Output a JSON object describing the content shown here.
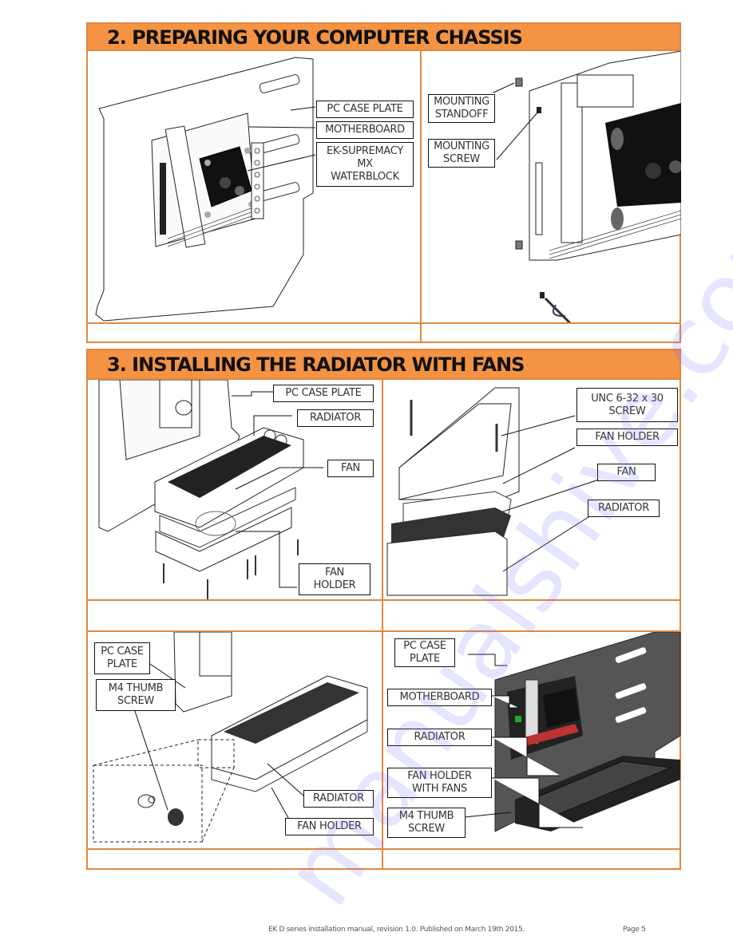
{
  "section2": {
    "title": "2.  PREPARING YOUR COMPUTER CHASSIS",
    "left_panel": {
      "labels": [
        "PC CASE PLATE",
        "MOTHERBOARD",
        "EK-SUPREMACY\nMX\nWATERBLOCK"
      ]
    },
    "right_panel": {
      "labels": [
        "MOUNTING\nSTANDOFF",
        "MOUNTING\nSCREW"
      ]
    },
    "captions": [
      "",
      ""
    ]
  },
  "section3": {
    "title": "3.  INSTALLING THE RADIATOR WITH FANS",
    "panel_top_left": {
      "labels": [
        "PC CASE PLATE",
        "RADIATOR",
        "FAN",
        "FAN\nHOLDER"
      ]
    },
    "panel_top_right": {
      "labels": [
        "UNC 6-32 x 30\nSCREW",
        "FAN HOLDER",
        "FAN",
        "RADIATOR"
      ]
    },
    "panel_bottom_left": {
      "labels": [
        "PC CASE\nPLATE",
        "M4 THUMB\nSCREW",
        "RADIATOR",
        "FAN HOLDER"
      ]
    },
    "panel_bottom_right": {
      "labels": [
        "PC CASE\nPLATE",
        "MOTHERBOARD",
        "RADIATOR",
        "FAN HOLDER\nWITH FANS",
        "M4 THUMB\nSCREW"
      ]
    },
    "captions": [
      "",
      "",
      "",
      ""
    ]
  },
  "watermark": "manualshive.com",
  "footer": {
    "text": "EK D series installation manual, revision 1.0. Published on March 19th 2015.",
    "page": "Page 5"
  },
  "colors": {
    "header_bg": "#f39343",
    "border": "#e0883f"
  }
}
